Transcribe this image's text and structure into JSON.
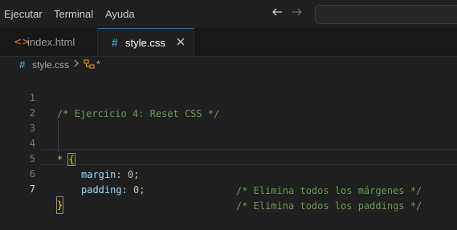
{
  "menu": {
    "items": [
      "Ejecutar",
      "Terminal",
      "Ayuda"
    ]
  },
  "nav": {
    "back_icon": "arrow-left-icon",
    "forward_icon": "arrow-right-icon"
  },
  "tabs": [
    {
      "label": "index.html",
      "icon": "html-file-icon",
      "active": false
    },
    {
      "label": "style.css",
      "icon": "css-file-icon",
      "active": true
    }
  ],
  "breadcrumb": {
    "file": "style.css",
    "symbol": "*"
  },
  "editor": {
    "lines": [
      {
        "n": "1",
        "comment": "/* Ejercicio 4: Reset CSS */"
      },
      {
        "n": "2"
      },
      {
        "n": "3"
      },
      {
        "n": "4",
        "selector": "*",
        "brace": "{"
      },
      {
        "n": "5",
        "prop": "margin",
        "colon": ":",
        "value": "0",
        "semi": ";",
        "comment": "/* Elimina todos los márgenes */"
      },
      {
        "n": "6",
        "prop": "padding",
        "colon": ":",
        "value": "0",
        "semi": ";",
        "comment": "/* Elimina todos los paddings */"
      },
      {
        "n": "7",
        "brace": "}"
      }
    ]
  },
  "colors": {
    "accent": "#0078d4",
    "comment": "#6a9955",
    "property": "#9cdcfe",
    "number": "#b5cea8",
    "brace": "#ffd700"
  }
}
